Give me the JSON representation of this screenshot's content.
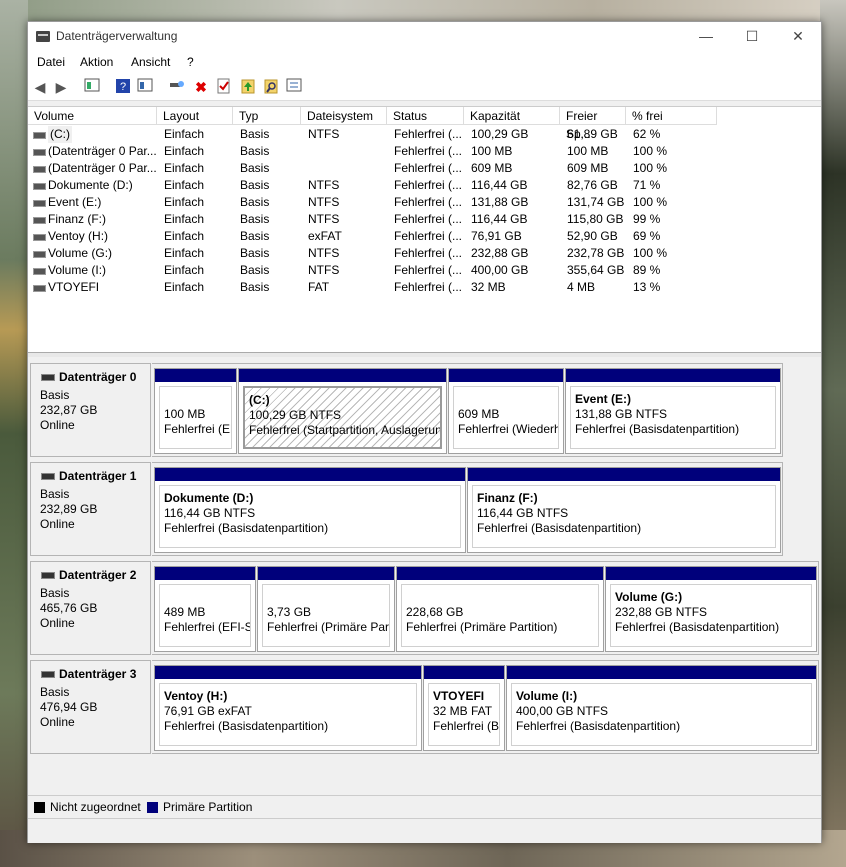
{
  "window": {
    "title": "Datenträgerverwaltung",
    "min": "—",
    "max": "☐",
    "close": "✕"
  },
  "menu": [
    "Datei",
    "Aktion",
    "Ansicht",
    "?"
  ],
  "toolbar_icons": [
    "back-icon",
    "forward-icon",
    "properties-icon",
    "help-icon",
    "view-icon",
    "connect-icon",
    "delete-icon",
    "check-icon",
    "up-icon",
    "search-icon",
    "list-icon"
  ],
  "columns": [
    "Volume",
    "Layout",
    "Typ",
    "Dateisystem",
    "Status",
    "Kapazität",
    "Freier Sp...",
    "% frei"
  ],
  "volumes": [
    [
      "(C:)",
      "Einfach",
      "Basis",
      "NTFS",
      "Fehlerfrei (...",
      "100,29 GB",
      "61,89 GB",
      "62 %"
    ],
    [
      "(Datenträger 0 Par...",
      "Einfach",
      "Basis",
      "",
      "Fehlerfrei (...",
      "100 MB",
      "100 MB",
      "100 %"
    ],
    [
      "(Datenträger 0 Par...",
      "Einfach",
      "Basis",
      "",
      "Fehlerfrei (...",
      "609 MB",
      "609 MB",
      "100 %"
    ],
    [
      "Dokumente (D:)",
      "Einfach",
      "Basis",
      "NTFS",
      "Fehlerfrei (...",
      "116,44 GB",
      "82,76 GB",
      "71 %"
    ],
    [
      "Event (E:)",
      "Einfach",
      "Basis",
      "NTFS",
      "Fehlerfrei (...",
      "131,88 GB",
      "131,74 GB",
      "100 %"
    ],
    [
      "Finanz (F:)",
      "Einfach",
      "Basis",
      "NTFS",
      "Fehlerfrei (...",
      "116,44 GB",
      "115,80 GB",
      "99 %"
    ],
    [
      "Ventoy (H:)",
      "Einfach",
      "Basis",
      "exFAT",
      "Fehlerfrei (...",
      "76,91 GB",
      "52,90 GB",
      "69 %"
    ],
    [
      "Volume (G:)",
      "Einfach",
      "Basis",
      "NTFS",
      "Fehlerfrei (...",
      "232,88 GB",
      "232,78 GB",
      "100 %"
    ],
    [
      "Volume (I:)",
      "Einfach",
      "Basis",
      "NTFS",
      "Fehlerfrei (...",
      "400,00 GB",
      "355,64 GB",
      "89 %"
    ],
    [
      "VTOYEFI",
      "Einfach",
      "Basis",
      "FAT",
      "Fehlerfrei (...",
      "32 MB",
      "4 MB",
      "13 %"
    ]
  ],
  "disks": [
    {
      "name": "Datenträger 0",
      "type": "Basis",
      "size": "232,87 GB",
      "state": "Online",
      "parts": [
        {
          "title": "",
          "size": "100 MB",
          "status": "Fehlerfrei (EF"
        },
        {
          "title": "(C:)",
          "size": "100,29 GB NTFS",
          "status": "Fehlerfrei (Startpartition, Auslagerung"
        },
        {
          "title": "",
          "size": "609 MB",
          "status": "Fehlerfrei (Wiederh"
        },
        {
          "title": "Event  (E:)",
          "size": "131,88 GB NTFS",
          "status": "Fehlerfrei (Basisdatenpartition)"
        }
      ]
    },
    {
      "name": "Datenträger 1",
      "type": "Basis",
      "size": "232,89 GB",
      "state": "Online",
      "parts": [
        {
          "title": "Dokumente  (D:)",
          "size": "116,44 GB NTFS",
          "status": "Fehlerfrei (Basisdatenpartition)"
        },
        {
          "title": "Finanz  (F:)",
          "size": "116,44 GB NTFS",
          "status": "Fehlerfrei (Basisdatenpartition)"
        }
      ]
    },
    {
      "name": "Datenträger 2",
      "type": "Basis",
      "size": "465,76 GB",
      "state": "Online",
      "parts": [
        {
          "title": "",
          "size": "489 MB",
          "status": "Fehlerfrei (EFI-Sy"
        },
        {
          "title": "",
          "size": "3,73 GB",
          "status": "Fehlerfrei (Primäre Parti"
        },
        {
          "title": "",
          "size": "228,68 GB",
          "status": "Fehlerfrei (Primäre Partition)"
        },
        {
          "title": "Volume  (G:)",
          "size": "232,88 GB NTFS",
          "status": "Fehlerfrei (Basisdatenpartition)"
        }
      ]
    },
    {
      "name": "Datenträger 3",
      "type": "Basis",
      "size": "476,94 GB",
      "state": "Online",
      "parts": [
        {
          "title": "Ventoy  (H:)",
          "size": "76,91 GB exFAT",
          "status": "Fehlerfrei (Basisdatenpartition)"
        },
        {
          "title": "VTOYEFI",
          "size": "32 MB FAT",
          "status": "Fehlerfrei (Ba"
        },
        {
          "title": "Volume  (I:)",
          "size": "400,00 GB NTFS",
          "status": "Fehlerfrei (Basisdatenpartition)"
        }
      ]
    }
  ],
  "legend": {
    "unallocated": "Nicht zugeordnet",
    "primary": "Primäre Partition",
    "unallocated_color": "#000000",
    "primary_color": "#00007b"
  }
}
